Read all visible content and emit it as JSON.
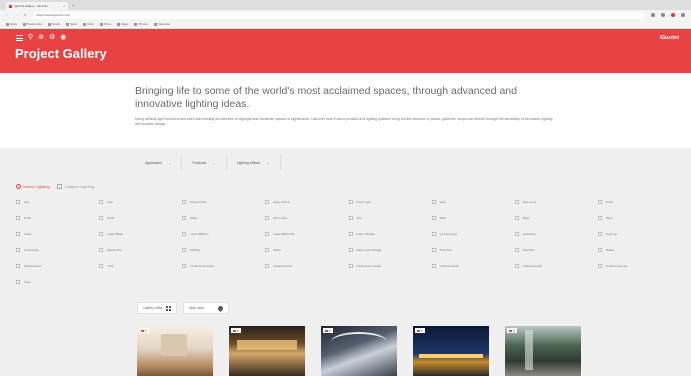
{
  "browser": {
    "tab_title": "Iguzzini Gallery - iGuzzini",
    "url": "https://www.iguzzini.com/",
    "bookmarks": [
      "Apps",
      "Bookmarks",
      "Gmail",
      "News",
      "Docs",
      "Drive",
      "Maps",
      "Photos",
      "Calendar"
    ]
  },
  "header": {
    "title": "Project Gallery",
    "logo": "iGuzzini"
  },
  "intro": {
    "headline": "Bringing life to some of the world's most acclaimed spaces, through advanced and innovative lighting ideas.",
    "body": "Using artificial light functions and work with existing architecture to highlight and illuminate spaces of significance. Discover how iGuzzini product and lighting systems bring out the essence of places, galleries, shops and streets through the sensitivity of innovative lighting and creative design."
  },
  "filters": [
    {
      "label": "Application"
    },
    {
      "label": "Products"
    },
    {
      "label": "Lighting effects"
    }
  ],
  "lighting_type": {
    "indoor": "Indoor Lighting",
    "outdoor": "Outdoor Lighting"
  },
  "categories": [
    "Ace",
    "Cup",
    "Deep Frame",
    "Easy Frame",
    "Front Light",
    "iLed",
    "iSee Lens",
    "iN 30",
    "iN 60",
    "iN 90",
    "iPlan",
    "iPro Linea",
    "iPro",
    "iRoll",
    "iSign",
    "iSign",
    "Laser",
    "Laser Blade",
    "Laser Blade L",
    "Laser Blade XS",
    "Laser Pinhole",
    "Le Perroquet",
    "Linealuce",
    "Light Up",
    "Lineaverde",
    "Master Pro",
    "MyWay",
    "Palco",
    "Palco Low Voltage",
    "Pixel Pro",
    "Pixel Pro",
    "Reflex",
    "Sanfrancisco",
    "Trick",
    "Underscore InOut",
    "Underscore15",
    "Underscore Linear",
    "Underscore15",
    "Underscore15",
    "Underscore Led",
    "View"
  ],
  "sort": {
    "label": "Gallery view",
    "map_label": "Map view"
  },
  "cards": [
    {
      "count": "5"
    },
    {
      "count": "6"
    },
    {
      "count": "5"
    },
    {
      "count": "5"
    },
    {
      "count": "6"
    }
  ]
}
